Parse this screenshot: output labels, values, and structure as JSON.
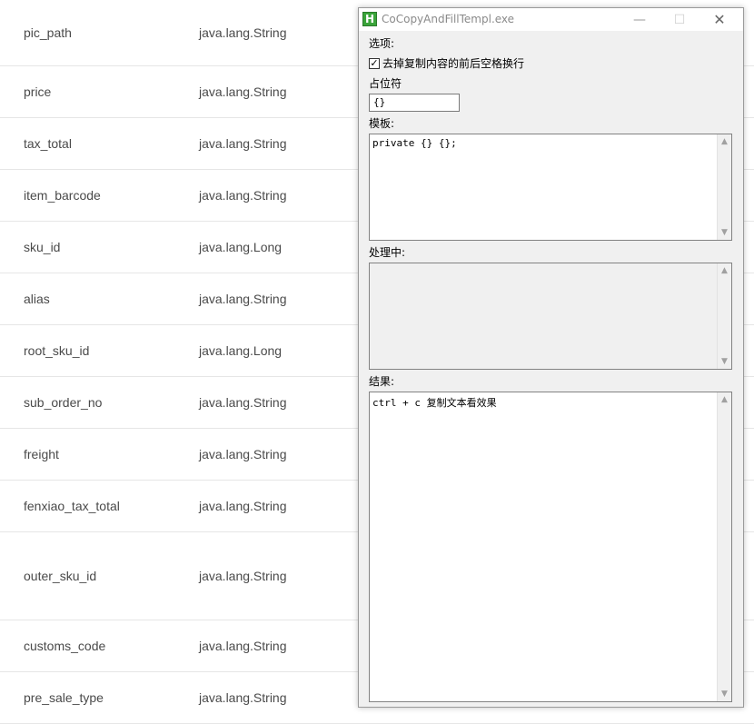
{
  "table": {
    "rows": [
      {
        "name": "pic_path",
        "type": "java.lang.String"
      },
      {
        "name": "price",
        "type": "java.lang.String"
      },
      {
        "name": "tax_total",
        "type": "java.lang.String"
      },
      {
        "name": "item_barcode",
        "type": "java.lang.String"
      },
      {
        "name": "sku_id",
        "type": "java.lang.Long"
      },
      {
        "name": "alias",
        "type": "java.lang.String"
      },
      {
        "name": "root_sku_id",
        "type": "java.lang.Long"
      },
      {
        "name": "sub_order_no",
        "type": "java.lang.String"
      },
      {
        "name": "freight",
        "type": "java.lang.String"
      },
      {
        "name": "fenxiao_tax_total",
        "type": "java.lang.String"
      },
      {
        "name": "outer_sku_id",
        "type": "java.lang.String"
      },
      {
        "name": "customs_code",
        "type": "java.lang.String"
      },
      {
        "name": "pre_sale_type",
        "type": "java.lang.String"
      }
    ]
  },
  "window": {
    "title": "CoCopyAndFillTempl.exe",
    "icon_letter": "H",
    "minimize_glyph": "—",
    "maximize_glyph": "☐",
    "close_glyph": "✕",
    "options_label": "选项:",
    "trim_checkbox_label": "去掉复制内容的前后空格换行",
    "trim_checked": true,
    "placeholder_label": "占位符",
    "placeholder_value": "{}",
    "template_label": "模板:",
    "template_value": "private {} {};",
    "processing_label": "处理中:",
    "processing_value": "",
    "result_label": "结果:",
    "result_value": "ctrl + c 复制文本看效果",
    "scroll_up_glyph": "▲",
    "scroll_down_glyph": "▼"
  }
}
